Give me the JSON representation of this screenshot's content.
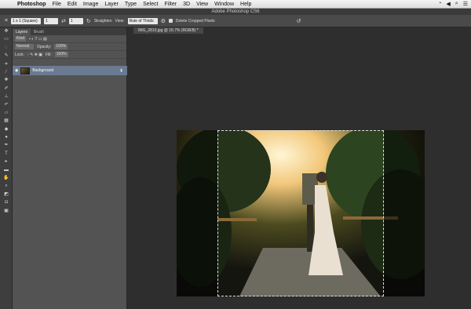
{
  "menubar": {
    "items": [
      "Photoshop",
      "File",
      "Edit",
      "Image",
      "Layer",
      "Type",
      "Select",
      "Filter",
      "3D",
      "View",
      "Window",
      "Help"
    ]
  },
  "title": "Adobe Photoshop CS6",
  "options": {
    "ratio": "1 x 1 (Square)",
    "width": "1",
    "height": "1",
    "straighten": "Straighten",
    "view_label": "View:",
    "view_value": "Rule of Thirds",
    "delete_cropped": "Delete Cropped Pixels"
  },
  "panel": {
    "tabs": [
      "Layers",
      "Brush"
    ],
    "kind": "Kind",
    "blend": "Normal",
    "opacity_label": "Opacity:",
    "opacity_value": "100%",
    "lock_label": "Lock:",
    "fill_label": "Fill:",
    "fill_value": "100%",
    "layer_name": "Background"
  },
  "document": {
    "tab": "IMG_2810.jpg @ 16.7% (RGB/8) *"
  }
}
